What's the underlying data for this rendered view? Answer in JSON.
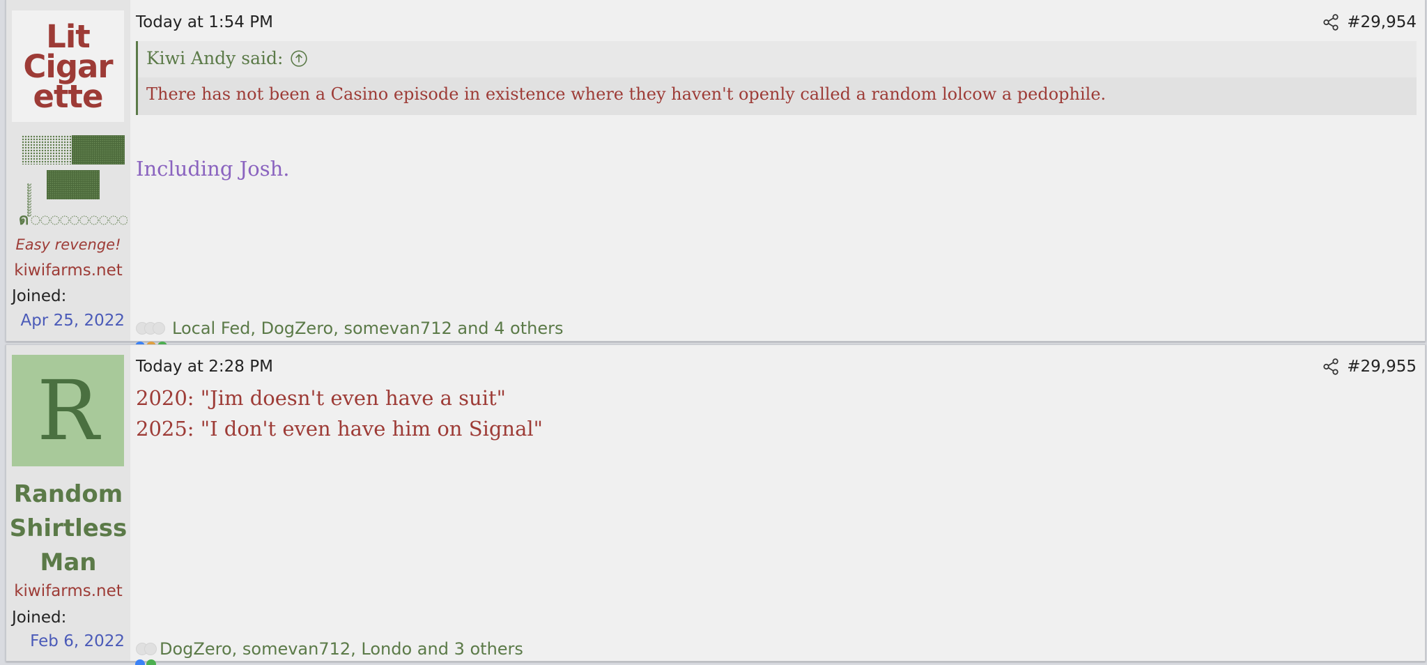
{
  "posts": [
    {
      "avatar_text": "Lit Cigar ette",
      "username": "",
      "user_title": "Easy revenge!",
      "site": "kiwifarms.net",
      "joined_label": "Joined:",
      "joined_date": "Apr 25, 2022",
      "date": "Today at 1:54 PM",
      "post_number": "#29,954",
      "quote": {
        "author": "Kiwi Andy said:",
        "text": "There has not been a Casino episode in existence where they haven't openly called a random lolcow a pedophile."
      },
      "message": [
        "Including Josh."
      ],
      "reactions_text": "Local Fed, DogZero, somevan712 and 4 others"
    },
    {
      "avatar_letter": "R",
      "username": "Random Shirtless Man",
      "site": "kiwifarms.net",
      "joined_label": "Joined:",
      "joined_date": "Feb 6, 2022",
      "date": "Today at 2:28 PM",
      "post_number": "#29,955",
      "message": [
        "2020: \"Jim doesn't even have a suit\"",
        "2025: \"I don't even have him on Signal\""
      ],
      "reactions_text": "DogZero, somevan712, Londo and 3 others"
    }
  ],
  "icons": {
    "share": "share-icon",
    "quote_jump": "arrow-up-circle-icon"
  },
  "colors": {
    "accent_green": "#5b7a48",
    "accent_red": "#9d3b36",
    "link_blue": "#4a5ab8",
    "purple": "#8a63bf"
  }
}
